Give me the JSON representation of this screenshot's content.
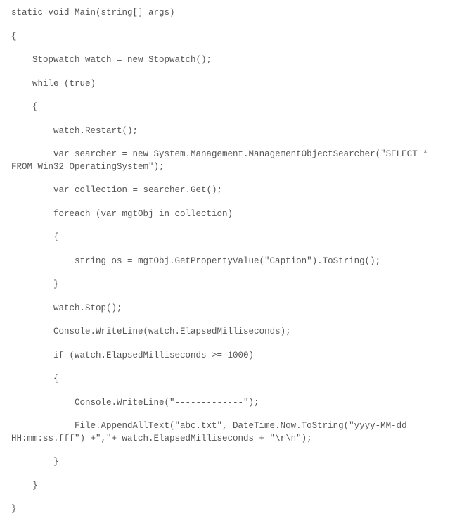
{
  "code": {
    "lines": [
      "static void Main(string[] args)",
      "{",
      "    Stopwatch watch = new Stopwatch();",
      "    while (true)",
      "    {",
      "        watch.Restart();",
      "        var searcher = new System.Management.ManagementObjectSearcher(\"SELECT * FROM Win32_OperatingSystem\");",
      "        var collection = searcher.Get();",
      "        foreach (var mgtObj in collection)",
      "        {",
      "            string os = mgtObj.GetPropertyValue(\"Caption\").ToString();",
      "        }",
      "        watch.Stop();",
      "        Console.WriteLine(watch.ElapsedMilliseconds);",
      "        if (watch.ElapsedMilliseconds >= 1000)",
      "        {",
      "            Console.WriteLine(\"-------------\");",
      "            File.AppendAllText(\"abc.txt\", DateTime.Now.ToString(\"yyyy-MM-dd HH:mm:ss.fff\") +\",\"+ watch.ElapsedMilliseconds + \"\\r\\n\");",
      "        }",
      "    }",
      "}"
    ]
  }
}
